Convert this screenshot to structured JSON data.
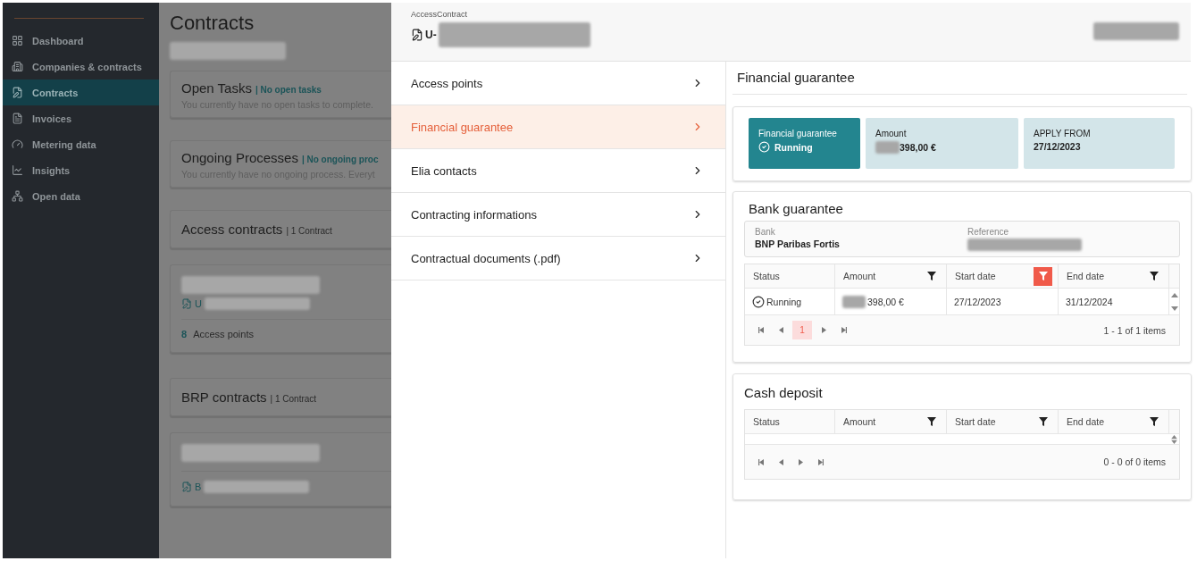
{
  "sidebar": {
    "items": [
      {
        "label": "Dashboard",
        "selected": false
      },
      {
        "label": "Companies & contracts",
        "selected": false
      },
      {
        "label": "Contracts",
        "selected": true
      },
      {
        "label": "Invoices",
        "selected": false
      },
      {
        "label": "Metering data",
        "selected": false
      },
      {
        "label": "Insights",
        "selected": false
      },
      {
        "label": "Open data",
        "selected": false
      }
    ]
  },
  "background_page": {
    "title": "Contracts",
    "sections": [
      {
        "kind": "status",
        "title": "Open Tasks",
        "status": "| No open tasks",
        "message": "You currently have no open tasks to complete."
      },
      {
        "kind": "status",
        "title": "Ongoing Processes",
        "status": "| No ongoing proc",
        "message": "You currently have no ongoing process. Everyt"
      },
      {
        "kind": "header",
        "title": "Access contracts",
        "count": "| 1 Contract"
      },
      {
        "kind": "contract",
        "id_prefix": "U",
        "points_count": "8",
        "points_label": "Access points"
      },
      {
        "kind": "header",
        "title": "BRP contracts",
        "count": "| 1 Contract"
      },
      {
        "kind": "contract",
        "id_prefix": "B"
      }
    ]
  },
  "drawer": {
    "header": {
      "type_label": "AccessContract",
      "id_prefix": "U-"
    },
    "menu": [
      {
        "label": "Access points",
        "selected": false
      },
      {
        "label": "Financial guarantee",
        "selected": true
      },
      {
        "label": "Elia contacts",
        "selected": false
      },
      {
        "label": "Contracting informations",
        "selected": false
      },
      {
        "label": "Contractual documents (.pdf)",
        "selected": false
      }
    ],
    "content": {
      "title": "Financial guarantee",
      "summary": {
        "status_title": "Financial guarantee",
        "status": "Running",
        "amount_label": "Amount",
        "amount": "398,00 €",
        "apply_label": "APPLY FROM",
        "apply_date": "27/12/2023"
      },
      "tables": [
        {
          "title": "Bank guarantee",
          "info": {
            "bank_label": "Bank",
            "bank_value": "BNP Paribas Fortis",
            "reference_label": "Reference"
          },
          "columns": [
            {
              "label": "Status",
              "kind": "plain",
              "filter_active": false
            },
            {
              "label": "Amount",
              "kind": "filter",
              "filter_active": false
            },
            {
              "label": "Start date",
              "kind": "filter",
              "filter_active": true
            },
            {
              "label": "End date",
              "kind": "filter",
              "filter_active": false
            }
          ],
          "rows": [
            {
              "status": "Running",
              "amount": "398,00 €",
              "start_date": "27/12/2023",
              "end_date": "31/12/2024"
            }
          ],
          "pages": [
            {
              "label": "1",
              "selected": true
            }
          ],
          "summary": "1 - 1 of 1 items"
        },
        {
          "title": "Cash deposit",
          "columns": [
            {
              "label": "Status",
              "kind": "plain",
              "filter_active": false
            },
            {
              "label": "Amount",
              "kind": "filter",
              "filter_active": false
            },
            {
              "label": "Start date",
              "kind": "filter",
              "filter_active": false
            },
            {
              "label": "End date",
              "kind": "filter",
              "filter_active": false
            }
          ],
          "summary": "0 - 0 of 0 items"
        }
      ]
    }
  }
}
